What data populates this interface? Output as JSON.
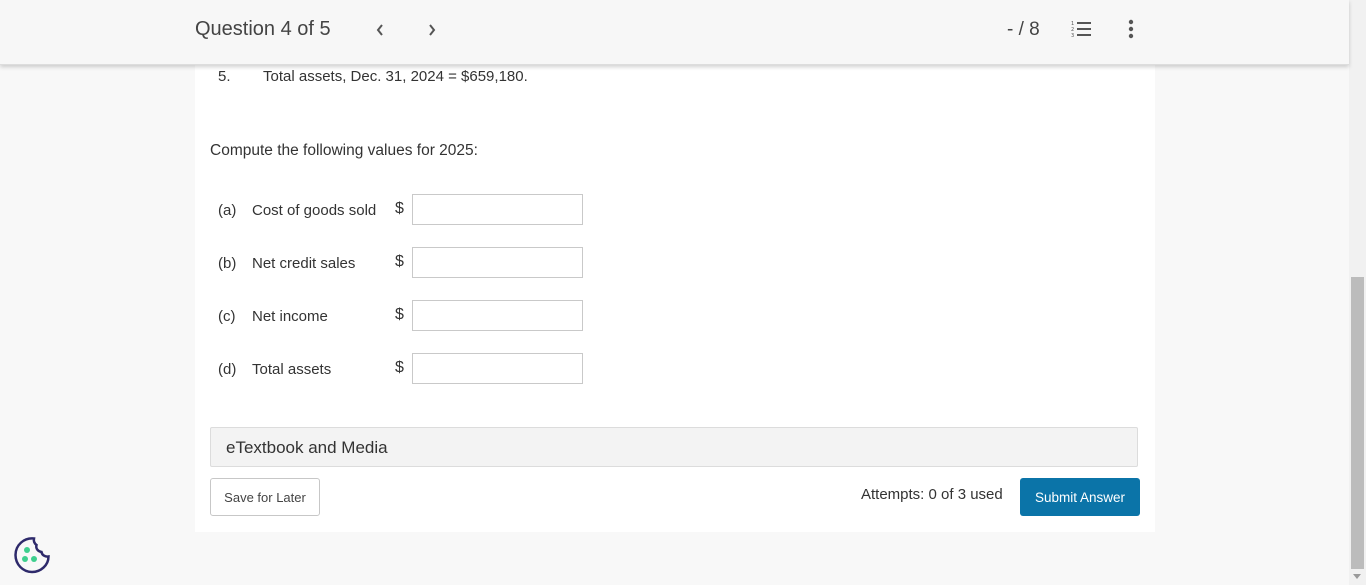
{
  "header": {
    "question_label": "Question 4 of 5",
    "prev_icon": "chevron-left-icon",
    "next_icon": "chevron-right-icon",
    "score": "- / 8",
    "list_icon": "numbered-list-icon",
    "more_icon": "more-vertical-icon"
  },
  "content": {
    "given_item": {
      "number": "5.",
      "text": "Total assets, Dec. 31, 2024 = $659,180."
    },
    "prompt": "Compute the following values for 2025:",
    "answers": [
      {
        "letter": "(a)",
        "label": "Cost of goods sold",
        "currency": "$",
        "value": ""
      },
      {
        "letter": "(b)",
        "label": "Net credit sales",
        "currency": "$",
        "value": ""
      },
      {
        "letter": "(c)",
        "label": "Net income",
        "currency": "$",
        "value": ""
      },
      {
        "letter": "(d)",
        "label": "Total assets",
        "currency": "$",
        "value": ""
      }
    ]
  },
  "etextbook": {
    "label": "eTextbook and Media"
  },
  "footer": {
    "save_label": "Save for Later",
    "attempts": "Attempts: 0 of 3 used",
    "submit_label": "Submit Answer"
  },
  "colors": {
    "submit_bg": "#0b74a8",
    "cookie_outline": "#2e2a6b",
    "cookie_dots": "#3ecf8e"
  },
  "cookie_icon": "cookie-icon"
}
